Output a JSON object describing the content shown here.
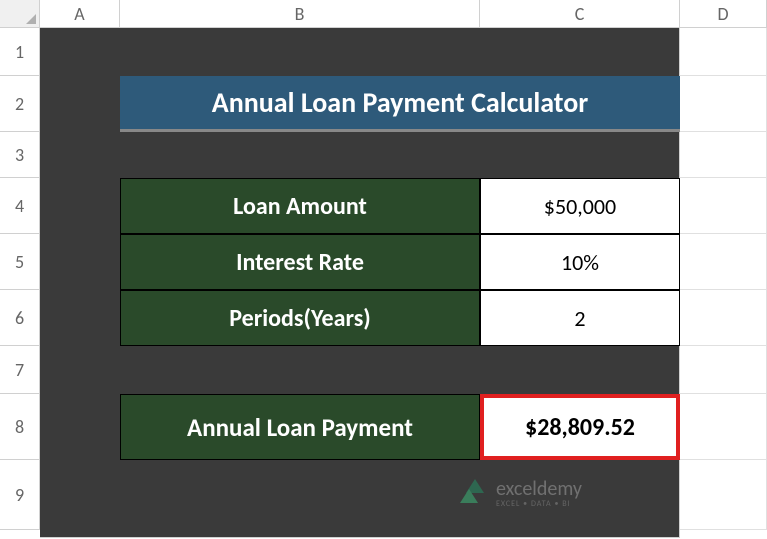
{
  "columns": {
    "a": "A",
    "b": "B",
    "c": "C",
    "d": "D"
  },
  "rows": {
    "r1": "1",
    "r2": "2",
    "r3": "3",
    "r4": "4",
    "r5": "5",
    "r6": "6",
    "r7": "7",
    "r8": "8",
    "r9": "9"
  },
  "title": "Annual Loan Payment Calculator",
  "inputs": {
    "loan_amount": {
      "label": "Loan Amount",
      "value": "$50,000"
    },
    "interest_rate": {
      "label": "Interest Rate",
      "value": "10%"
    },
    "periods": {
      "label": "Periods(Years)",
      "value": "2"
    }
  },
  "result": {
    "label": "Annual Loan Payment",
    "value": "$28,809.52"
  },
  "watermark": {
    "brand": "exceldemy",
    "tagline": "EXCEL • DATA • BI"
  },
  "chart_data": {
    "type": "table",
    "title": "Annual Loan Payment Calculator",
    "rows": [
      {
        "label": "Loan Amount",
        "value": 50000,
        "display": "$50,000"
      },
      {
        "label": "Interest Rate",
        "value": 0.1,
        "display": "10%"
      },
      {
        "label": "Periods(Years)",
        "value": 2,
        "display": "2"
      },
      {
        "label": "Annual Loan Payment",
        "value": 28809.52,
        "display": "$28,809.52"
      }
    ]
  }
}
